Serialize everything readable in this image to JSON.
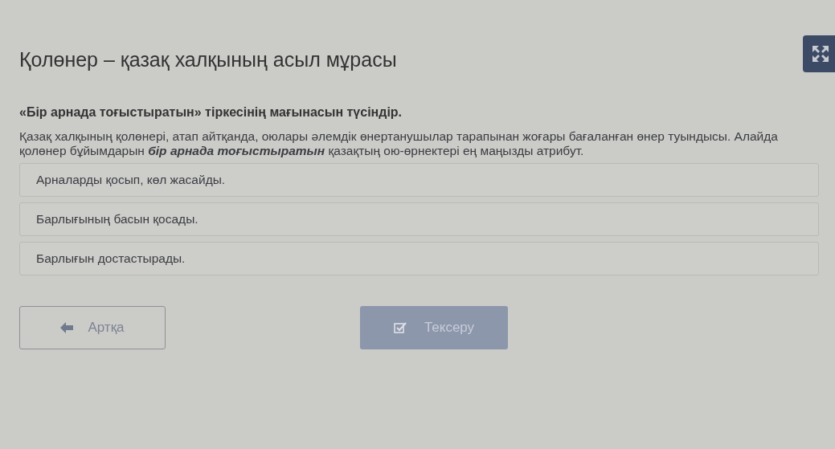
{
  "title": "Қолөнер – қазақ халқының асыл мұрасы",
  "question": "«Бір арнада тоғыстыратын» тіркесінің мағынасын түсіндір.",
  "passage": "Қазақ халқының қолөнері, атап айтқанда, оюлары әлемдік өнертанушылар тарапынан жоғары бағаланған өнер туындысы. Алайда қолөнер бұйымдарын **бір арнада тоғыстыратын** қазақтың ою-өрнектері ең маңызды атрибут.",
  "options": [
    {
      "label": "Арналарды қосып, көл жасайды.",
      "selected": false
    },
    {
      "label": "Барлығының басын қосады.",
      "selected": false
    },
    {
      "label": "Барлығын достастырады.",
      "selected": false
    }
  ],
  "back_button": {
    "label": "Артқа"
  },
  "check_button": {
    "label": "Тексеру",
    "disabled": true
  }
}
